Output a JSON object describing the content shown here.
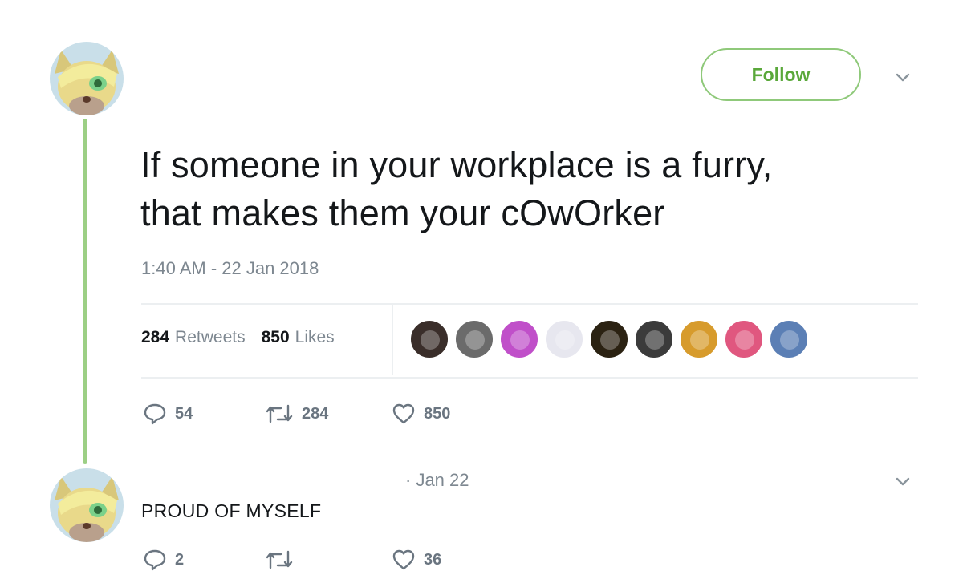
{
  "tweet": {
    "follow_label": "Follow",
    "text_line1": "If someone in your workplace is a furry,",
    "text_line2": "that makes them your cOwOrker",
    "timestamp": "1:40 AM - 22 Jan 2018",
    "stats": {
      "retweets_count": "284",
      "retweets_label": "Retweets",
      "likes_count": "850",
      "likes_label": "Likes"
    },
    "liker_avatars": [
      {
        "name": "liker-avatar-1",
        "color": "#3a2e2a"
      },
      {
        "name": "liker-avatar-2",
        "color": "#6b6b6b"
      },
      {
        "name": "liker-avatar-3",
        "color": "#c04fc9"
      },
      {
        "name": "liker-avatar-4",
        "color": "#e7e7ef"
      },
      {
        "name": "liker-avatar-5",
        "color": "#2b2212"
      },
      {
        "name": "liker-avatar-6",
        "color": "#3b3b3b"
      },
      {
        "name": "liker-avatar-7",
        "color": "#d79b2c"
      },
      {
        "name": "liker-avatar-8",
        "color": "#e0577f"
      },
      {
        "name": "liker-avatar-9",
        "color": "#5b7fb5"
      }
    ],
    "actions": {
      "reply_count": "54",
      "retweet_count": "284",
      "like_count": "850"
    }
  },
  "reply": {
    "date": "· Jan 22",
    "text": "PROUD OF MYSELF",
    "actions": {
      "reply_count": "2",
      "retweet_count": "",
      "like_count": "36"
    }
  },
  "colors": {
    "accent_green": "#5aa83a",
    "thread_line": "#9ccf85",
    "muted_text": "#7d8790"
  }
}
